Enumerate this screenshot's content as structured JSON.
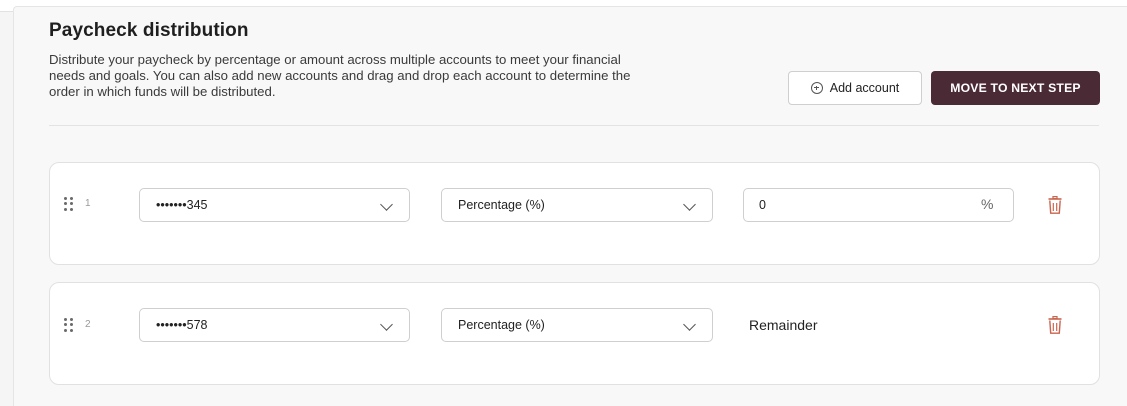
{
  "header": {
    "title": "Paycheck distribution",
    "description": "Distribute your paycheck by percentage or amount across multiple accounts to meet your financial needs and goals. You can also add new accounts and drag and drop each account to determine the order in which funds will be distributed."
  },
  "actions": {
    "add_account_label": "Add account",
    "next_step_label": "MOVE TO NEXT STEP"
  },
  "rows": [
    {
      "number": "1",
      "account": "•••••••345",
      "type": "Percentage (%)",
      "amount_value": "0",
      "amount_suffix": "%"
    },
    {
      "number": "2",
      "account": "•••••••578",
      "type": "Percentage (%)",
      "remainder_label": "Remainder"
    }
  ],
  "icons": {
    "add": "plus-circle-icon",
    "drag": "drag-handle-icon",
    "dropdown": "chevron-down-icon",
    "delete": "trash-icon"
  },
  "colors": {
    "primary_button": "#4a2a34",
    "delete_icon": "#c9654f"
  }
}
